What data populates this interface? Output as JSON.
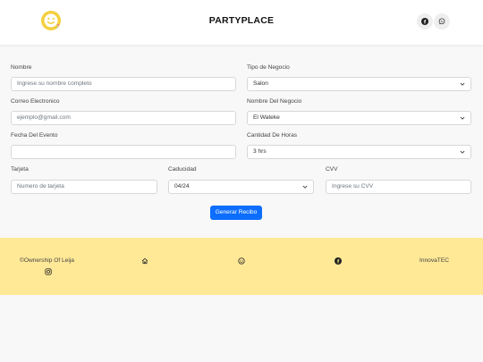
{
  "header": {
    "brand": "PARTYPLACE",
    "logo_icon": "smiley-logo",
    "social_icons": [
      "facebook-icon",
      "whatsapp-icon"
    ]
  },
  "form": {
    "nombre": {
      "label": "Nombre",
      "placeholder": "Ingrese su nombre completo"
    },
    "tipo_negocio": {
      "label": "Tipo de Negocio",
      "value": "Salon"
    },
    "correo": {
      "label": "Correo Electronico",
      "placeholder": "ejemplo@gmail.com"
    },
    "nombre_negocio": {
      "label": "Nombre Del Negocio",
      "value": "El Wateke"
    },
    "fecha": {
      "label": "Fecha Del Evento",
      "value": ""
    },
    "cantidad_horas": {
      "label": "Cantidad De Horas",
      "value": "3 hrs"
    },
    "tarjeta": {
      "label": "Tarjeta",
      "placeholder": "Numero de tarjeta"
    },
    "caducidad": {
      "label": "Caducidad",
      "value": "04/24"
    },
    "cvv": {
      "label": "CVV",
      "placeholder": "Ingrese su CVV"
    },
    "submit_label": "Generar Recibo"
  },
  "footer": {
    "ownership": "©Ownership Of Leija",
    "company": "InnovaTEC",
    "icons": [
      "home-icon",
      "smile-icon",
      "facebook-icon",
      "instagram-icon"
    ]
  },
  "colors": {
    "accent": "#0d6efd",
    "footer_bg": "#ffe896",
    "logo_yellow": "#f4d03f"
  }
}
